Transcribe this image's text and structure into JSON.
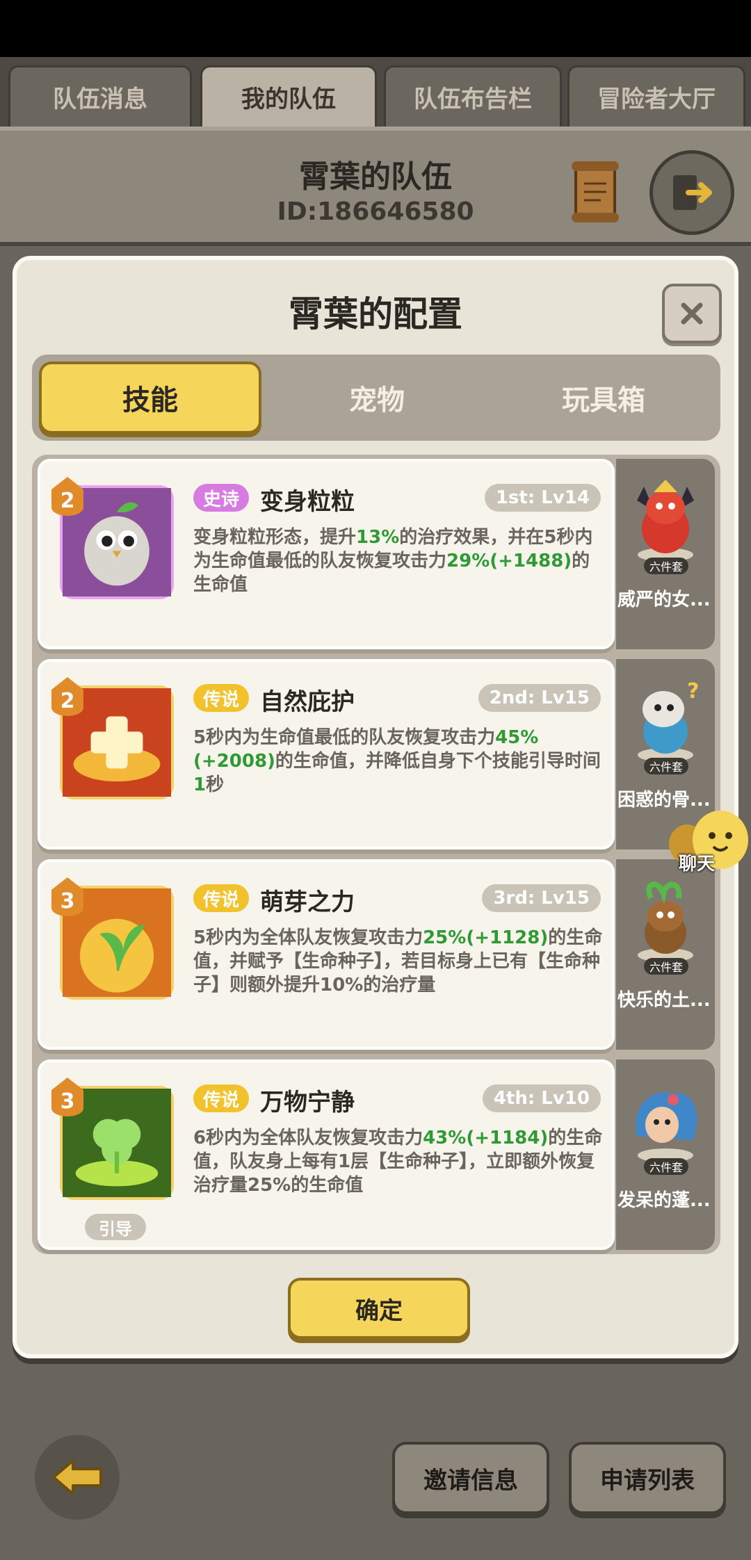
{
  "top_tabs": [
    {
      "label": "队伍消息",
      "active": false
    },
    {
      "label": "我的队伍",
      "active": true
    },
    {
      "label": "队伍布告栏",
      "active": false
    },
    {
      "label": "冒险者大厅",
      "active": false
    }
  ],
  "team": {
    "name": "霄葉的队伍",
    "id": "ID:186646580"
  },
  "dialog": {
    "title": "霄葉的配置",
    "tabs": [
      {
        "label": "技能",
        "active": true
      },
      {
        "label": "宠物",
        "active": false
      },
      {
        "label": "玩具箱",
        "active": false
      }
    ],
    "skills": [
      {
        "level": "2",
        "rarity": "史诗",
        "name": "变身粒粒",
        "slot": "1st: Lv14",
        "desc": [
          "变身粒粒形态，提升",
          "13%",
          "的治疗效果，并在5秒内为生命值最低的队友恢复攻击力",
          "29%(+1488)",
          "的生命值"
        ]
      },
      {
        "level": "2",
        "rarity": "传说",
        "name": "自然庇护",
        "slot": "2nd: Lv15",
        "desc": [
          "5秒内为生命值最低的队友恢复攻击力",
          "45%(+2008)",
          "的生命值，并降低自身下个技能引导时间",
          "1",
          "秒"
        ]
      },
      {
        "level": "3",
        "rarity": "传说",
        "name": "萌芽之力",
        "slot": "3rd: Lv15",
        "desc": [
          "5秒内为全体队友恢复攻击力",
          "25%(+1128)",
          "的生命值，并赋予【生命种子】，若目标身上已有【生命种子】则额外提升10%的治疗量"
        ]
      },
      {
        "level": "3",
        "rarity": "传说",
        "name": "万物宁静",
        "slot": "4th: Lv10",
        "chip": "引导",
        "desc": [
          "6秒内为全体队友恢复攻击力",
          "43%(+1184)",
          "的生命值，队友身上每有1层【生命种子】，立即额外恢复治疗量25%的生命值"
        ]
      }
    ],
    "pets": [
      {
        "set": "六件套",
        "name": "威严的女..."
      },
      {
        "set": "六件套",
        "name": "困惑的骨..."
      },
      {
        "set": "六件套",
        "name": "快乐的土..."
      },
      {
        "set": "六件套",
        "name": "发呆的蓬..."
      }
    ],
    "confirm_label": "确定"
  },
  "chat_label": "聊天",
  "bottom": {
    "invite_label": "邀请信息",
    "apply_label": "申请列表"
  }
}
